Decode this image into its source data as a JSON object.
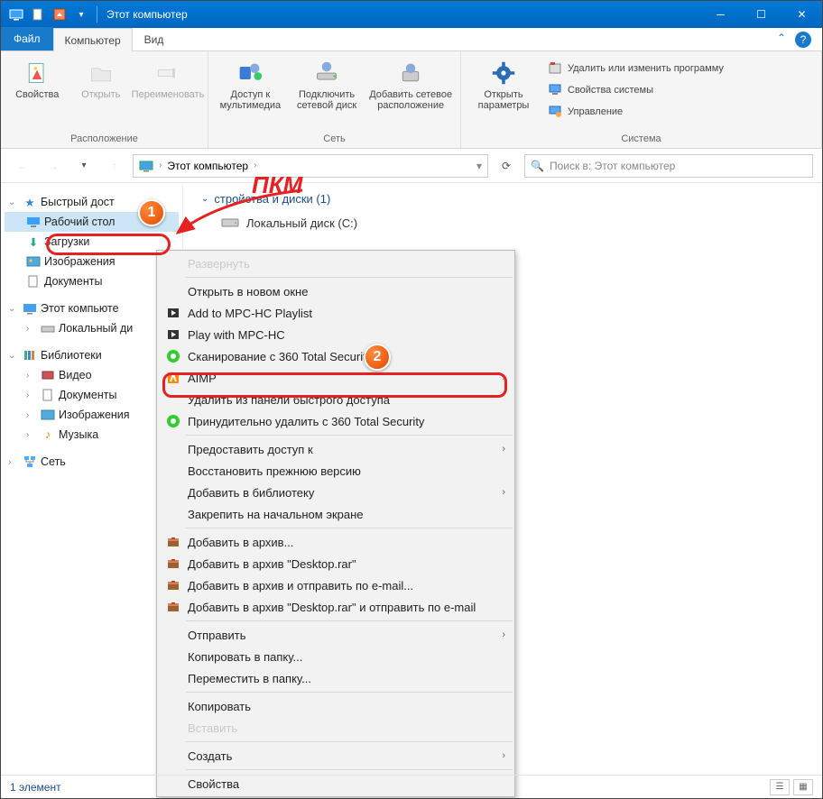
{
  "title": "Этот компьютер",
  "tabs": {
    "file": "Файл",
    "computer": "Компьютер",
    "view": "Вид"
  },
  "ribbon": {
    "props": "Свойства",
    "open": "Открыть",
    "rename": "Переименовать",
    "group_location": "Расположение",
    "media": "Доступ к\nмультимедиа",
    "netdrive": "Подключить\nсетевой диск",
    "netloc": "Добавить сетевое\nрасположение",
    "group_network": "Сеть",
    "settings": "Открыть\nпараметры",
    "uninstall": "Удалить или изменить программу",
    "sysprops": "Свойства системы",
    "manage": "Управление",
    "group_system": "Система"
  },
  "breadcrumb": {
    "root": "Этот компьютер"
  },
  "search_placeholder": "Поиск в: Этот компьютер",
  "tree": {
    "quick": "Быстрый дост",
    "desktop": "Рабочий стол",
    "downloads": "Загрузки",
    "pictures": "Изображения",
    "documents": "Документы",
    "thispc": "Этот компьюте",
    "localdisk": "Локальный ди",
    "libraries": "Библиотеки",
    "video": "Видео",
    "libdocs": "Документы",
    "libpics": "Изображения",
    "music": "Музыка",
    "network": "Сеть"
  },
  "content": {
    "group": "стройства и диски (1)",
    "drive": "Локальный диск (C:)"
  },
  "ctx": {
    "expand": "Развернуть",
    "newwin": "Открыть в новом окне",
    "mpc_add": "Add to MPC-HC Playlist",
    "mpc_play": "Play with MPC-HC",
    "scan360": "Сканирование с 360 Total Security",
    "aimp": "AIMP",
    "unpin": "Удалить из панели быстрого доступа",
    "force360": "Принудительно удалить с  360 Total Security",
    "share": "Предоставить доступ к",
    "prev": "Восстановить прежнюю версию",
    "addlib": "Добавить в библиотеку",
    "pinstart": "Закрепить на начальном экране",
    "arc1": "Добавить в архив...",
    "arc2": "Добавить в архив \"Desktop.rar\"",
    "arc3": "Добавить в архив и отправить по e-mail...",
    "arc4": "Добавить в архив \"Desktop.rar\" и отправить по e-mail",
    "send": "Отправить",
    "copyto": "Копировать в папку...",
    "moveto": "Переместить в папку...",
    "copy": "Копировать",
    "paste": "Вставить",
    "new": "Создать",
    "props": "Свойства"
  },
  "annotations": {
    "pkm": "ПКМ",
    "b1": "1",
    "b2": "2"
  },
  "status": "1 элемент"
}
